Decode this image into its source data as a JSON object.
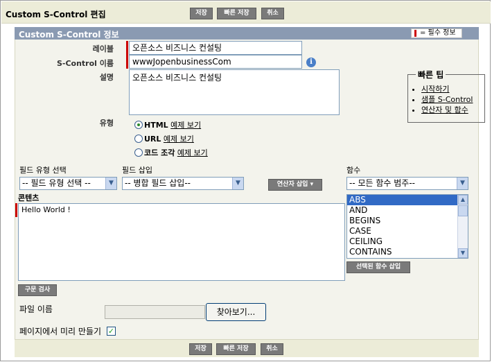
{
  "header": {
    "title": "Custom S-Control 편집",
    "buttons": {
      "save": "저장",
      "quick_save": "빠른 저장",
      "cancel": "취소"
    }
  },
  "section": {
    "title": "Custom S-Control 정보",
    "required_legend": "= 필수 정보"
  },
  "fields": {
    "label": {
      "label": "레이블",
      "value": "오픈소스 비즈니스 컨설팅"
    },
    "name": {
      "label": "S-Control 이름",
      "value": "wwwJopenbusinessCom"
    },
    "description": {
      "label": "설명",
      "value": "오픈소스 비즈니스 컨설팅"
    },
    "type": {
      "label": "유형",
      "options": [
        {
          "label": "HTML",
          "link": "예제 보기",
          "selected": true
        },
        {
          "label": "URL",
          "link": "예제 보기",
          "selected": false
        },
        {
          "label": "코드 조각",
          "link": "예제 보기",
          "selected": false
        }
      ]
    }
  },
  "quick_tips": {
    "title": "빠른 팁",
    "links": [
      "시작하기",
      "샘플 S-Control",
      "연산자 및 함수"
    ]
  },
  "builder": {
    "field_type_label": "필드 유형 선택",
    "field_type_value": "-- 필드 유형 선택 --",
    "insert_field_label": "필드 삽입",
    "insert_field_value": "-- 병합 필드 삽입--",
    "insert_operator_button": "연산자 삽입",
    "functions_label": "함수",
    "functions_category_value": "-- 모든 함수 범주--",
    "functions_list": [
      "ABS",
      "AND",
      "BEGINS",
      "CASE",
      "CEILING",
      "CONTAINS"
    ],
    "functions_selected": "ABS",
    "insert_function_button": "선택된 함수 삽입"
  },
  "content": {
    "label": "콘텐츠",
    "value": "Hello World !",
    "syntax_check_button": "구문 검사"
  },
  "file": {
    "label": "파일 이름",
    "browse_button": "찾아보기..."
  },
  "preview": {
    "label": "페이지에서 미리 만들기",
    "checked": true
  }
}
